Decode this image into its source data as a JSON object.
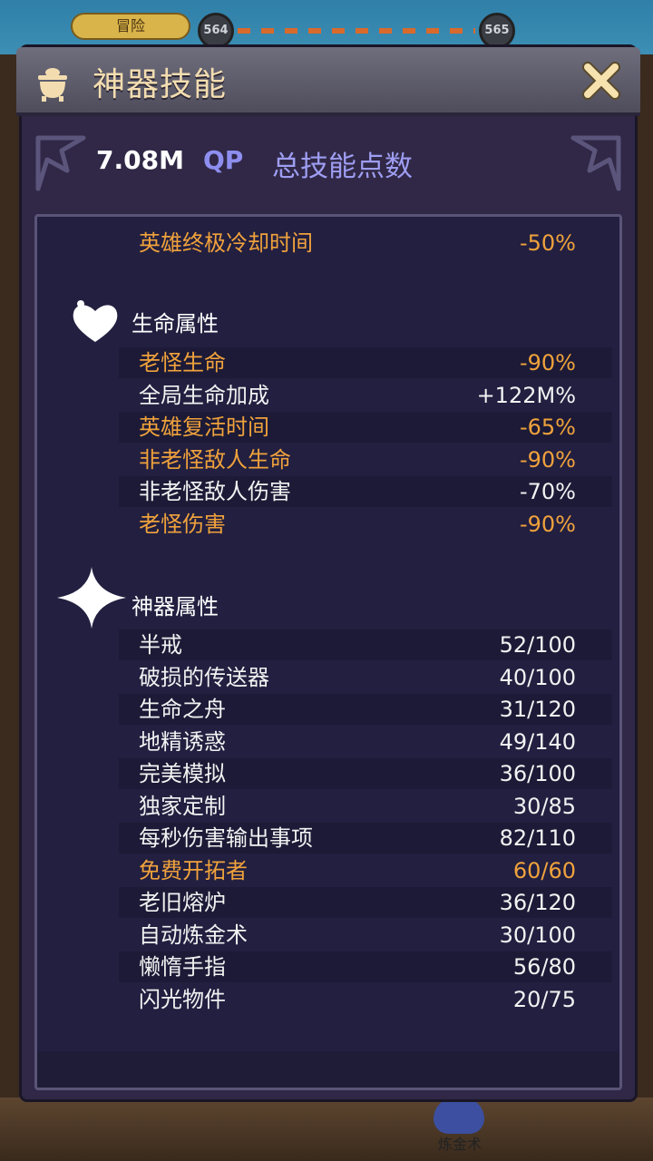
{
  "background": {
    "tab_label": "冒险",
    "node_left": "564",
    "node_right": "565",
    "bottom_label": "炼金术"
  },
  "dialog": {
    "title": "神器技能",
    "close_icon": "close-x-icon",
    "header_icon": "cauldron-icon"
  },
  "qp": {
    "value": "7.08M",
    "unit": "QP",
    "label": "总技能点数"
  },
  "top_row": {
    "label": "英雄终极冷却时间",
    "value": "-50%"
  },
  "sections": {
    "life": {
      "title": "生命属性",
      "icon": "heart-icon",
      "rows": [
        {
          "label": "老怪生命",
          "value": "-90%",
          "color": "#f0a23c"
        },
        {
          "label": "全局生命加成",
          "value": "+122M%",
          "color": "#f2f2f2"
        },
        {
          "label": "英雄复活时间",
          "value": "-65%",
          "color": "#f0a23c"
        },
        {
          "label": "非老怪敌人生命",
          "value": "-90%",
          "color": "#f0a23c"
        },
        {
          "label": "非老怪敌人伤害",
          "value": "-70%",
          "color": "#f2f2f2"
        },
        {
          "label": "老怪伤害",
          "value": "-90%",
          "color": "#f0a23c"
        }
      ]
    },
    "artifact": {
      "title": "神器属性",
      "icon": "sparkle-icon",
      "rows": [
        {
          "label": "半戒",
          "value": "52/100",
          "color": "#f2f2f2"
        },
        {
          "label": "破损的传送器",
          "value": "40/100",
          "color": "#f2f2f2"
        },
        {
          "label": "生命之舟",
          "value": "31/120",
          "color": "#f2f2f2"
        },
        {
          "label": "地精诱惑",
          "value": "49/140",
          "color": "#f2f2f2"
        },
        {
          "label": "完美模拟",
          "value": "36/100",
          "color": "#f2f2f2"
        },
        {
          "label": "独家定制",
          "value": "30/85",
          "color": "#f2f2f2"
        },
        {
          "label": "每秒伤害输出事项",
          "value": "82/110",
          "color": "#f2f2f2"
        },
        {
          "label": "免费开拓者",
          "value": "60/60",
          "color": "#f0a23c"
        },
        {
          "label": "老旧熔炉",
          "value": "36/120",
          "color": "#f2f2f2"
        },
        {
          "label": "自动炼金术",
          "value": "30/100",
          "color": "#f2f2f2"
        },
        {
          "label": "懒惰手指",
          "value": "56/80",
          "color": "#f2f2f2"
        },
        {
          "label": "闪光物件",
          "value": "20/75",
          "color": "#f2f2f2"
        }
      ]
    }
  }
}
